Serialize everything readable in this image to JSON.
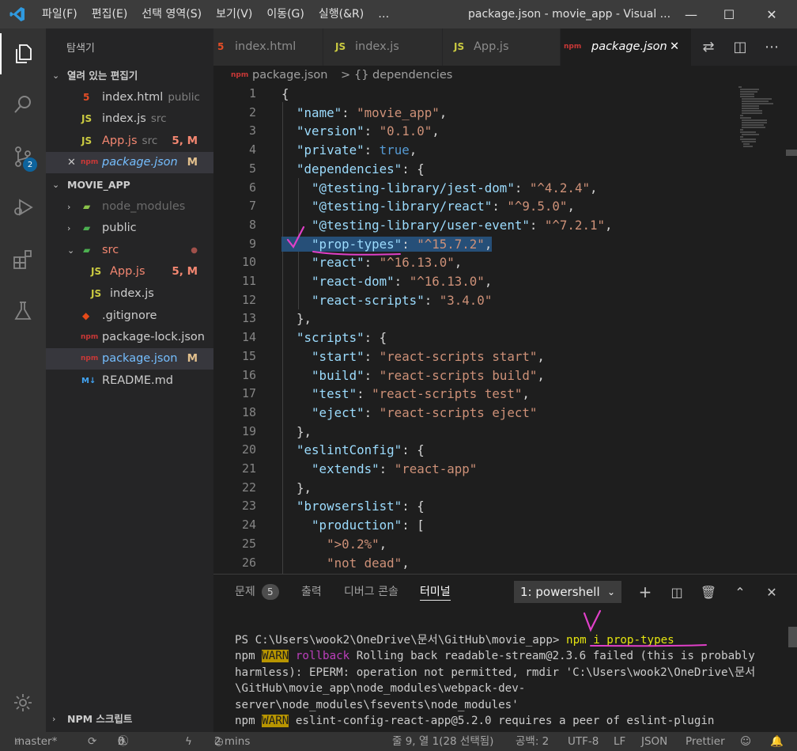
{
  "titlebar": {
    "menu": [
      "파일(F)",
      "편집(E)",
      "선택 영역(S)",
      "보기(V)",
      "이동(G)",
      "실행(&R)",
      "…"
    ],
    "title": "package.json - movie_app - Visual ...",
    "minimize": "—",
    "maximize": "☐",
    "close": "✕"
  },
  "activitybar": {
    "items": [
      "explorer-icon",
      "search-icon",
      "source-control-icon",
      "run-debug-icon",
      "extensions-icon",
      "testing-icon"
    ],
    "scm_badge": "2",
    "accounts": "gear-icon"
  },
  "sidebar": {
    "title": "탐색기",
    "open_editors": {
      "label": "열려 있는 편집기",
      "items": [
        {
          "icon": "5",
          "name": "index.html",
          "sub": "public",
          "status": ""
        },
        {
          "icon": "JS",
          "name": "index.js",
          "sub": "src",
          "status": ""
        },
        {
          "icon": "JS",
          "name": "App.js",
          "sub": "src",
          "status": "5, M"
        },
        {
          "icon": "npm",
          "name": "package.json",
          "sub": "",
          "status": "M",
          "close": "✕"
        }
      ]
    },
    "project": {
      "label": "MOVIE_APP",
      "items": [
        {
          "name": "node_modules",
          "chev": "›"
        },
        {
          "name": "public",
          "chev": "›"
        },
        {
          "name": "src",
          "chev": "⌄",
          "status": "●"
        },
        {
          "name": "App.js",
          "status": "5, M"
        },
        {
          "name": "index.js"
        },
        {
          "name": ".gitignore"
        },
        {
          "name": "package-lock.json"
        },
        {
          "name": "package.json",
          "status": "M"
        },
        {
          "name": "README.md"
        }
      ]
    },
    "npm_scripts": "NPM 스크립트"
  },
  "tabs": [
    {
      "icon": "5",
      "label": "index.html"
    },
    {
      "icon": "JS",
      "label": "index.js"
    },
    {
      "icon": "JS",
      "label": "App.js"
    },
    {
      "icon": "npm",
      "label": "package.json",
      "close": "✕"
    }
  ],
  "breadcrumb": {
    "file": "package.json",
    "sep": ">",
    "symbol": "{} dependencies"
  },
  "editor": {
    "lines": [
      {
        "n": "1",
        "t": [
          [
            "p",
            "{"
          ]
        ]
      },
      {
        "n": "2",
        "t": [
          [
            "p",
            "  "
          ],
          [
            "k",
            "\"name\""
          ],
          [
            "p",
            ": "
          ],
          [
            "s",
            "\"movie_app\""
          ],
          [
            "p",
            ","
          ]
        ]
      },
      {
        "n": "3",
        "t": [
          [
            "p",
            "  "
          ],
          [
            "k",
            "\"version\""
          ],
          [
            "p",
            ": "
          ],
          [
            "s",
            "\"0.1.0\""
          ],
          [
            "p",
            ","
          ]
        ]
      },
      {
        "n": "4",
        "t": [
          [
            "p",
            "  "
          ],
          [
            "k",
            "\"private\""
          ],
          [
            "p",
            ": "
          ],
          [
            "b",
            "true"
          ],
          [
            "p",
            ","
          ]
        ]
      },
      {
        "n": "5",
        "t": [
          [
            "p",
            "  "
          ],
          [
            "k",
            "\"dependencies\""
          ],
          [
            "p",
            ": {"
          ]
        ]
      },
      {
        "n": "6",
        "t": [
          [
            "p",
            "    "
          ],
          [
            "k",
            "\"@testing-library/jest-dom\""
          ],
          [
            "p",
            ": "
          ],
          [
            "s",
            "\"^4.2.4\""
          ],
          [
            "p",
            ","
          ]
        ]
      },
      {
        "n": "7",
        "t": [
          [
            "p",
            "    "
          ],
          [
            "k",
            "\"@testing-library/react\""
          ],
          [
            "p",
            ": "
          ],
          [
            "s",
            "\"^9.5.0\""
          ],
          [
            "p",
            ","
          ]
        ]
      },
      {
        "n": "8",
        "t": [
          [
            "p",
            "    "
          ],
          [
            "k",
            "\"@testing-library/user-event\""
          ],
          [
            "p",
            ": "
          ],
          [
            "s",
            "\"^7.2.1\""
          ],
          [
            "p",
            ","
          ]
        ]
      },
      {
        "n": "9",
        "t": [
          [
            "p",
            "    "
          ],
          [
            "k",
            "\"prop-types\""
          ],
          [
            "p",
            ": "
          ],
          [
            "s",
            "\"^15.7.2\""
          ],
          [
            "p",
            ","
          ]
        ]
      },
      {
        "n": "10",
        "t": [
          [
            "p",
            "    "
          ],
          [
            "k",
            "\"react\""
          ],
          [
            "p",
            ": "
          ],
          [
            "s",
            "\"^16.13.0\""
          ],
          [
            "p",
            ","
          ]
        ]
      },
      {
        "n": "11",
        "t": [
          [
            "p",
            "    "
          ],
          [
            "k",
            "\"react-dom\""
          ],
          [
            "p",
            ": "
          ],
          [
            "s",
            "\"^16.13.0\""
          ],
          [
            "p",
            ","
          ]
        ]
      },
      {
        "n": "12",
        "t": [
          [
            "p",
            "    "
          ],
          [
            "k",
            "\"react-scripts\""
          ],
          [
            "p",
            ": "
          ],
          [
            "s",
            "\"3.4.0\""
          ]
        ]
      },
      {
        "n": "13",
        "t": [
          [
            "p",
            "  },"
          ]
        ]
      },
      {
        "n": "14",
        "t": [
          [
            "p",
            "  "
          ],
          [
            "k",
            "\"scripts\""
          ],
          [
            "p",
            ": {"
          ]
        ]
      },
      {
        "n": "15",
        "t": [
          [
            "p",
            "    "
          ],
          [
            "k",
            "\"start\""
          ],
          [
            "p",
            ": "
          ],
          [
            "s",
            "\"react-scripts start\""
          ],
          [
            "p",
            ","
          ]
        ]
      },
      {
        "n": "16",
        "t": [
          [
            "p",
            "    "
          ],
          [
            "k",
            "\"build\""
          ],
          [
            "p",
            ": "
          ],
          [
            "s",
            "\"react-scripts build\""
          ],
          [
            "p",
            ","
          ]
        ]
      },
      {
        "n": "17",
        "t": [
          [
            "p",
            "    "
          ],
          [
            "k",
            "\"test\""
          ],
          [
            "p",
            ": "
          ],
          [
            "s",
            "\"react-scripts test\""
          ],
          [
            "p",
            ","
          ]
        ]
      },
      {
        "n": "18",
        "t": [
          [
            "p",
            "    "
          ],
          [
            "k",
            "\"eject\""
          ],
          [
            "p",
            ": "
          ],
          [
            "s",
            "\"react-scripts eject\""
          ]
        ]
      },
      {
        "n": "19",
        "t": [
          [
            "p",
            "  },"
          ]
        ]
      },
      {
        "n": "20",
        "t": [
          [
            "p",
            "  "
          ],
          [
            "k",
            "\"eslintConfig\""
          ],
          [
            "p",
            ": {"
          ]
        ]
      },
      {
        "n": "21",
        "t": [
          [
            "p",
            "    "
          ],
          [
            "k",
            "\"extends\""
          ],
          [
            "p",
            ": "
          ],
          [
            "s",
            "\"react-app\""
          ]
        ]
      },
      {
        "n": "22",
        "t": [
          [
            "p",
            "  },"
          ]
        ]
      },
      {
        "n": "23",
        "t": [
          [
            "p",
            "  "
          ],
          [
            "k",
            "\"browserslist\""
          ],
          [
            "p",
            ": {"
          ]
        ]
      },
      {
        "n": "24",
        "t": [
          [
            "p",
            "    "
          ],
          [
            "k",
            "\"production\""
          ],
          [
            "p",
            ": ["
          ]
        ]
      },
      {
        "n": "25",
        "t": [
          [
            "p",
            "      "
          ],
          [
            "s",
            "\">0.2%\""
          ],
          [
            "p",
            ","
          ]
        ]
      },
      {
        "n": "26",
        "t": [
          [
            "p",
            "      "
          ],
          [
            "s",
            "\"not dead\""
          ],
          [
            "p",
            ","
          ]
        ]
      }
    ]
  },
  "panel": {
    "tabs": [
      "문제",
      "출력",
      "디버그 콘솔",
      "터미널"
    ],
    "problems_count": "5",
    "terminal_select": "1: powershell",
    "terminal": {
      "prompt": "PS C:\\Users\\wook2\\OneDrive\\문서\\GitHub\\movie_app> ",
      "command": "npm i prop-types",
      "line2_a": "npm ",
      "warn": "WARN",
      "rollback": "rollback",
      "line2_b": " Rolling back readable-stream@2.3.6 failed (this is probably harmless): EPERM: operation not permitted, rmdir 'C:\\Users\\wook2\\OneDrive\\문서\\GitHub\\movie_app\\node_modules\\webpack-dev-server\\node_modules\\fsevents\\node_modules'",
      "line3_a": "npm ",
      "line3_b": " eslint-config-react-app@5.2.0 requires a peer of eslint-plugin"
    }
  },
  "statusbar": {
    "branch": "master*",
    "errors": "5",
    "warnings": "0",
    "time": "2 mins",
    "cursor": "줄 9, 열 1(28 선택됨)",
    "spaces": "공백: 2",
    "encoding": "UTF-8",
    "eol": "LF",
    "language": "JSON",
    "formatter": "Prettier"
  },
  "colors": {
    "accent": "#007acc",
    "warn": "#b89500",
    "annotation": "#e040c8"
  }
}
